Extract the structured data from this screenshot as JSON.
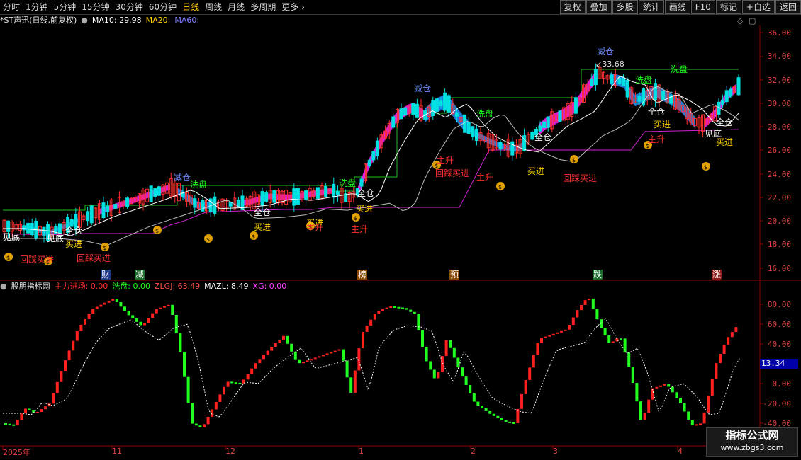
{
  "toolbar": {
    "periods": [
      "分时",
      "1分钟",
      "5分钟",
      "15分钟",
      "30分钟",
      "60分钟",
      "日线",
      "周线",
      "月线",
      "多周期",
      "更多"
    ],
    "active_period": "日线",
    "buttons": [
      "复权",
      "叠加",
      "多股",
      "统计",
      "画线",
      "F10",
      "标记",
      "+自选",
      "返回"
    ]
  },
  "main_legend": {
    "title": "*ST声迅(日线,前复权)",
    "ma10": "MA10: 29.98",
    "ma20": "MA20:",
    "ma60": "MA60:"
  },
  "sub_legend": {
    "title": "股朋指标网",
    "zlj": "主力进场: 0.00",
    "xp": "洗盘: 0.00",
    "zlgj": "ZLGJ: 63.49",
    "mazl": "MAZL: 8.49",
    "xg": "XG: 0.00"
  },
  "price_axis": [
    "36.00",
    "34.00",
    "32.00",
    "30.00",
    "28.00",
    "26.00",
    "24.00",
    "22.00",
    "20.00",
    "18.00",
    "16.00"
  ],
  "osc_axis": [
    "80.00",
    "60.00",
    "40.00",
    "20.00",
    "0.00",
    "-20.00",
    "-40.00"
  ],
  "osc_current": "13.34",
  "high_label": "33.68",
  "date_labels": [
    "2025年",
    "11",
    "12",
    "1",
    "2",
    "3",
    "4"
  ],
  "category_tags": [
    "财",
    "减",
    "榜",
    "预",
    "跌",
    "涨"
  ],
  "annotations": {
    "jiancang": "减仓",
    "xipan": "洗盘",
    "quancang": "全仓",
    "maijin": "买进",
    "huicai": "回踩买进",
    "zhusheng": "主升",
    "jiandi": "见底"
  },
  "watermark": {
    "line1": "指标公式网",
    "line2": "www.zbgs3.com"
  },
  "colors": {
    "up": "#ff3030",
    "down": "#00e0e0",
    "osc_up": "#ff2020",
    "osc_down": "#20ff20",
    "accent": "#ffd200"
  }
}
